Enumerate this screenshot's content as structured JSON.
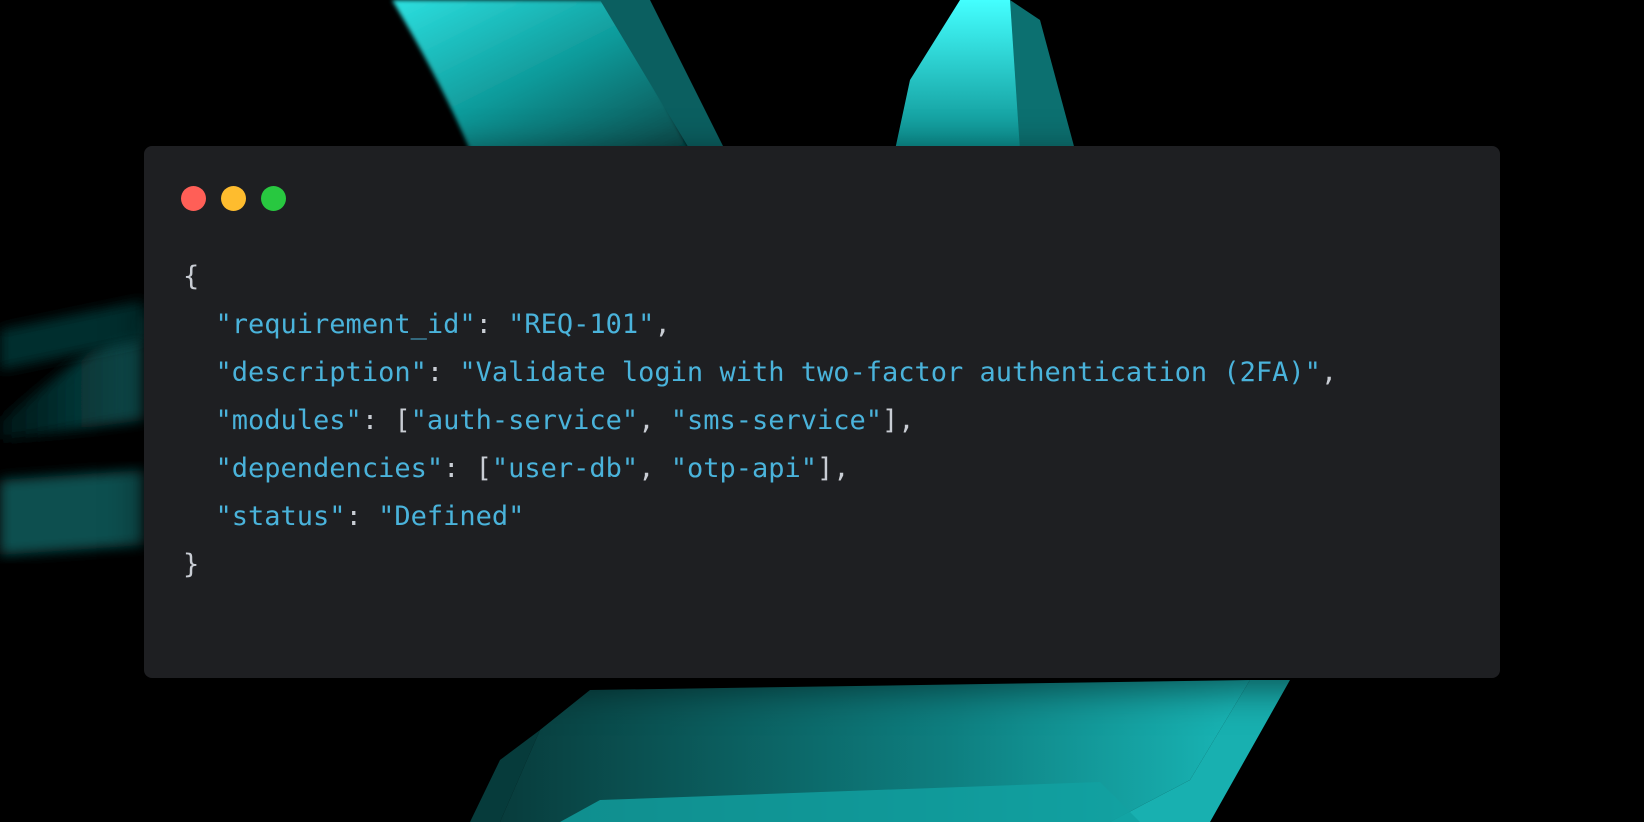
{
  "window": {
    "buttons": [
      {
        "name": "close",
        "color": "#ff5f57"
      },
      {
        "name": "minimize",
        "color": "#febc2e"
      },
      {
        "name": "zoom",
        "color": "#28c840"
      }
    ]
  },
  "colors": {
    "window_bg": "#1e1f22",
    "text": "#c9cdd4",
    "string": "#4ab3db",
    "accent_teal": "#1fd4d4"
  },
  "code": {
    "open_brace": "{",
    "close_brace": "}",
    "fields": [
      {
        "key": "\"requirement_id\"",
        "value": "\"REQ-101\"",
        "suffix": ","
      },
      {
        "key": "\"description\"",
        "value": "\"Validate login with two-factor authentication (2FA)\"",
        "suffix": ","
      },
      {
        "key": "\"modules\"",
        "items": [
          "\"auth-service\"",
          "\"sms-service\""
        ],
        "suffix": ","
      },
      {
        "key": "\"dependencies\"",
        "items": [
          "\"user-db\"",
          "\"otp-api\""
        ],
        "suffix": ","
      },
      {
        "key": "\"status\"",
        "value": "\"Defined\"",
        "suffix": ""
      }
    ]
  }
}
